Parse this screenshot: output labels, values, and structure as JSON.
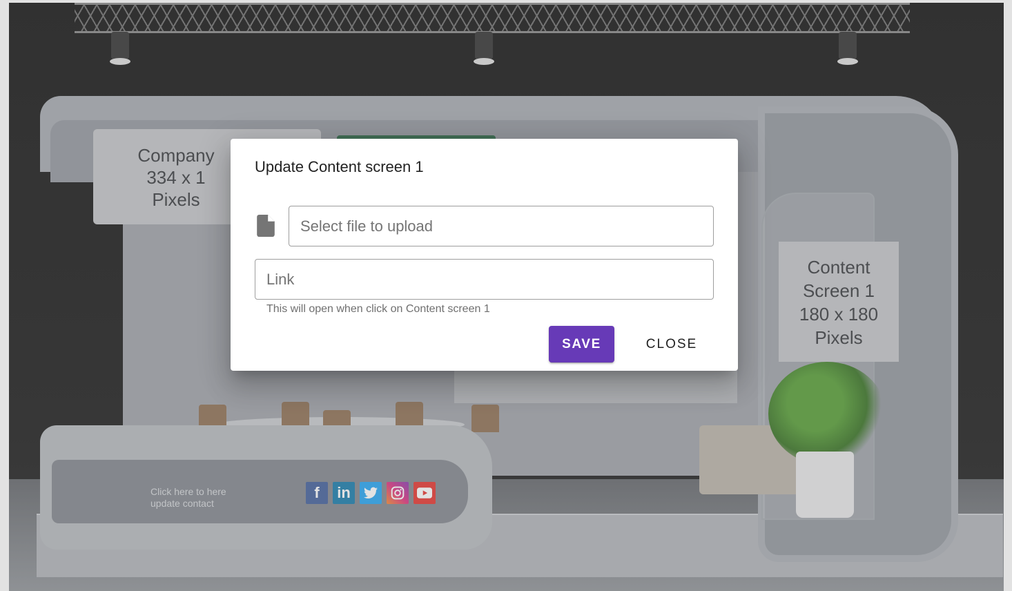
{
  "scene": {
    "company_panel_lines": [
      "Company",
      "334 x 1",
      "Pixels"
    ],
    "content_panel_lines": [
      "Content",
      "Screen 1",
      "180 x 180",
      "Pixels"
    ],
    "desk_text_line1": "Click here to here",
    "desk_text_line2": "update contact",
    "social_icons": [
      "facebook-icon",
      "linkedin-icon",
      "twitter-icon",
      "instagram-icon",
      "youtube-icon"
    ],
    "social_glyphs": [
      "f",
      "in",
      "",
      "",
      ""
    ]
  },
  "dialog": {
    "title": "Update Content screen 1",
    "file_placeholder": "Select file to upload",
    "link_placeholder": "Link",
    "link_hint": "This will open when click on Content screen 1",
    "save_label": "SAVE",
    "close_label": "CLOSE"
  },
  "colors": {
    "accent": "#673ab7"
  }
}
